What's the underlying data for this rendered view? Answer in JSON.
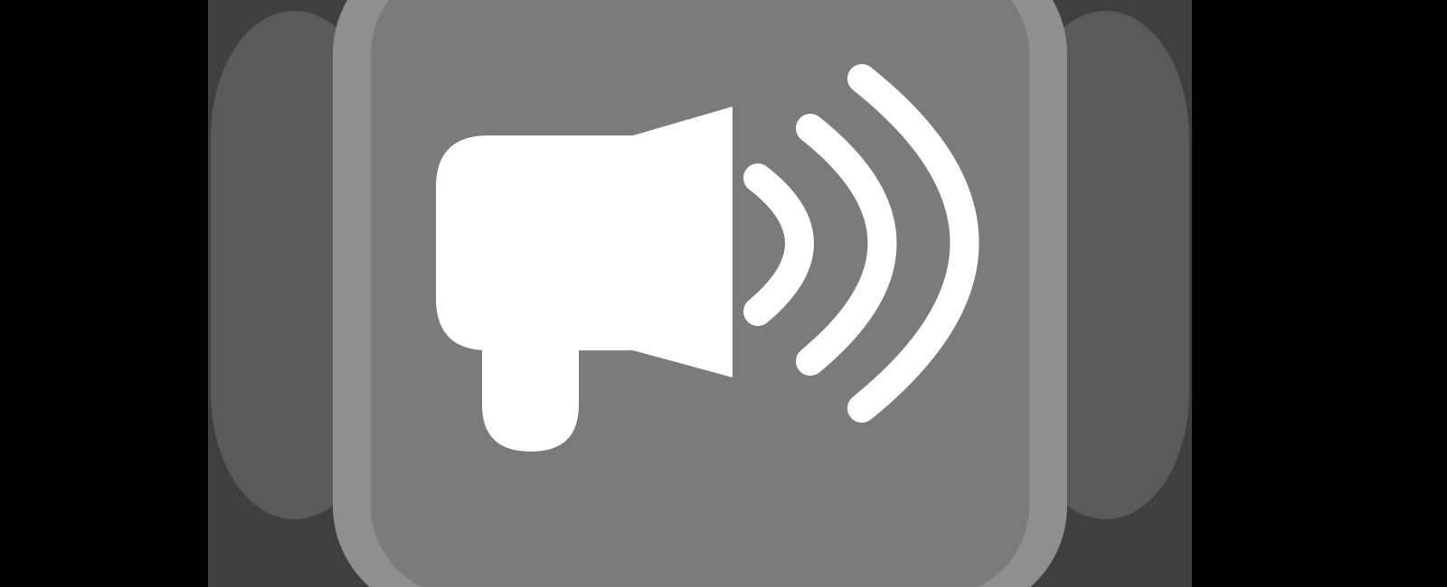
{
  "icon": {
    "name": "megaphone-icon",
    "waves_icon": "sound-waves-icon"
  },
  "colors": {
    "background": "#000000",
    "panel": "#3f3f3f",
    "side_shape": "#5a5a5a",
    "frame": "#8f8f8f",
    "inner": "#7b7b7b",
    "glyph": "#ffffff"
  }
}
